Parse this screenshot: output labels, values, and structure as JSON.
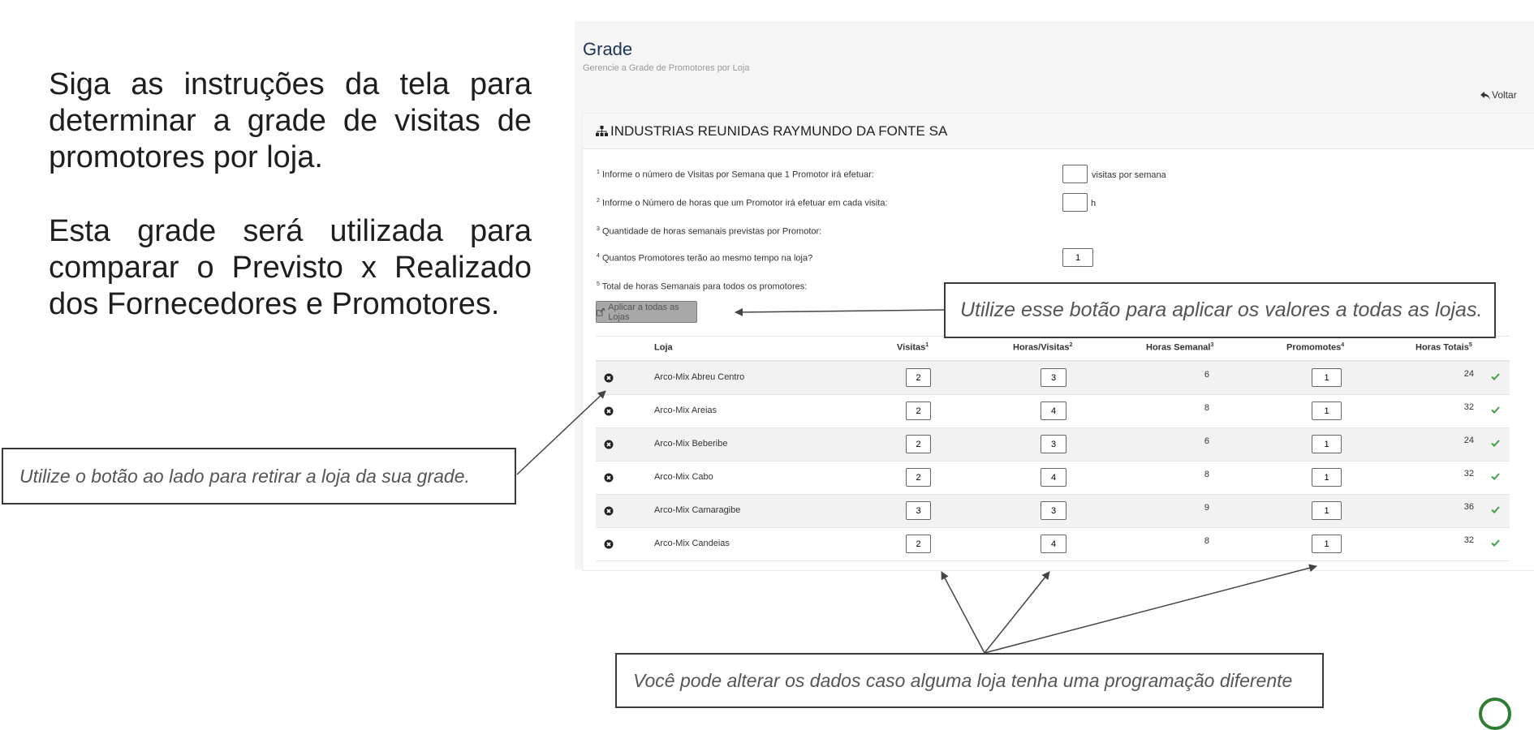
{
  "intro": {
    "para1": "Siga as instruções da tela para determinar a grade de visitas de promotores por loja.",
    "para2": "Esta grade será utilizada para comparar o Previsto x Realizado dos Fornecedores e Promotores."
  },
  "callouts": {
    "remove_hint": "Utilize o botão ao lado para retirar a loja da sua grade.",
    "apply_hint": "Utilize esse botão para aplicar os valores a todas as lojas.",
    "edit_hint": "Você pode alterar os dados caso alguma loja tenha uma programação diferente"
  },
  "header": {
    "title": "Grade",
    "subtitle": "Gerencie a Grade de Promotores por Loja",
    "back_label": "Voltar"
  },
  "card": {
    "title": "INDUSTRIAS REUNIDAS RAYMUNDO DA FONTE SA"
  },
  "form": {
    "q1": {
      "num": "1",
      "text": "Informe o número de Visitas por Semana que 1 Promotor irá efetuar:",
      "value": "",
      "suffix": "visitas por semana"
    },
    "q2": {
      "num": "2",
      "text": "Informe o Número de horas que um Promotor irá efetuar em cada visita:",
      "value": "",
      "suffix": "h"
    },
    "q3": {
      "num": "3",
      "text": "Quantidade de horas semanais previstas por Promotor:"
    },
    "q4": {
      "num": "4",
      "text": "Quantos Promotores terão ao mesmo tempo na loja?",
      "value": "1"
    },
    "q5": {
      "num": "5",
      "text": "Total de horas Semanais para todos os promotores:"
    },
    "apply_label": "Aplicar a todas as Lojas"
  },
  "table": {
    "columns": [
      {
        "label": "Loja",
        "sup": ""
      },
      {
        "label": "Visitas",
        "sup": "1"
      },
      {
        "label": "Horas/Visitas",
        "sup": "2"
      },
      {
        "label": "Horas Semanal",
        "sup": "3"
      },
      {
        "label": "Promomotes",
        "sup": "4"
      },
      {
        "label": "Horas Totais",
        "sup": "5"
      }
    ],
    "rows": [
      {
        "store": "Arco-Mix Abreu Centro",
        "visitas": "2",
        "horas_visita": "3",
        "horas_semanal": "6",
        "promotores": "1",
        "horas_totais": "24"
      },
      {
        "store": "Arco-Mix Areias",
        "visitas": "2",
        "horas_visita": "4",
        "horas_semanal": "8",
        "promotores": "1",
        "horas_totais": "32"
      },
      {
        "store": "Arco-Mix Beberibe",
        "visitas": "2",
        "horas_visita": "3",
        "horas_semanal": "6",
        "promotores": "1",
        "horas_totais": "24"
      },
      {
        "store": "Arco-Mix Cabo",
        "visitas": "2",
        "horas_visita": "4",
        "horas_semanal": "8",
        "promotores": "1",
        "horas_totais": "32"
      },
      {
        "store": "Arco-Mix Camaragibe",
        "visitas": "3",
        "horas_visita": "3",
        "horas_semanal": "9",
        "promotores": "1",
        "horas_totais": "36"
      },
      {
        "store": "Arco-Mix Candeias",
        "visitas": "2",
        "horas_visita": "4",
        "horas_semanal": "8",
        "promotores": "1",
        "horas_totais": "32"
      }
    ]
  },
  "colors": {
    "check": "#43a047",
    "title": "#1d3557"
  }
}
